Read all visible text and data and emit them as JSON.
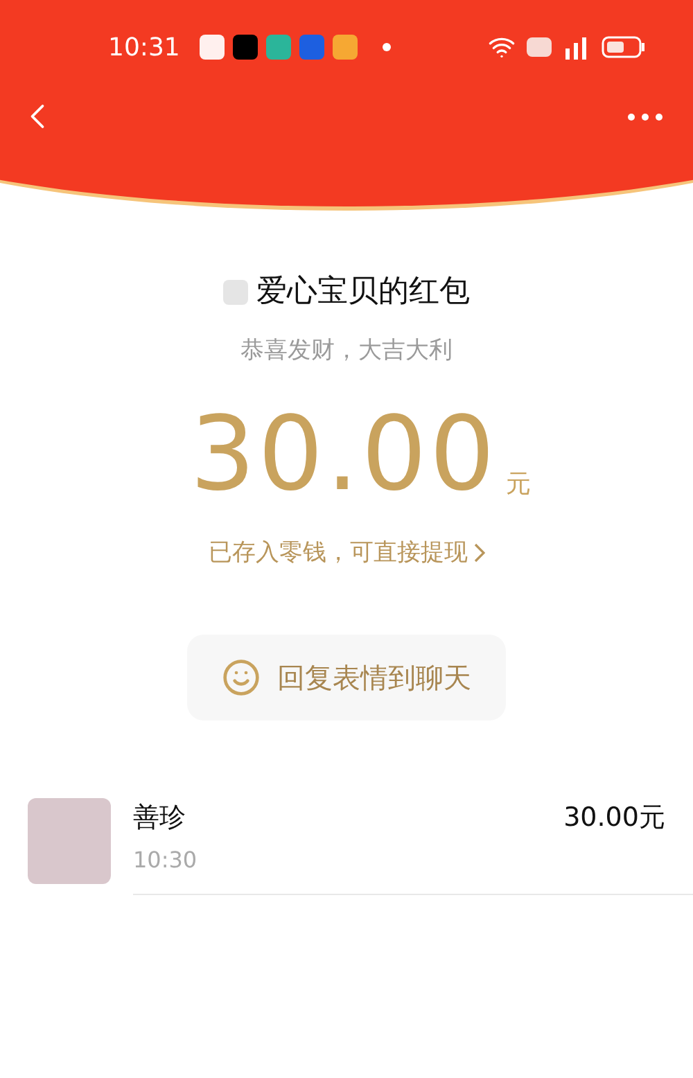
{
  "status_bar": {
    "time": "10:31"
  },
  "envelope": {
    "sender_title": "爱心宝贝的红包",
    "greeting": "恭喜发财，大吉大利",
    "amount": "30.00",
    "unit": "元",
    "note": "已存入零钱，可直接提现",
    "reply_button": "回复表情到聊天"
  },
  "recipients": [
    {
      "name": "善珍",
      "time": "10:30",
      "amount": "30.00元"
    }
  ]
}
